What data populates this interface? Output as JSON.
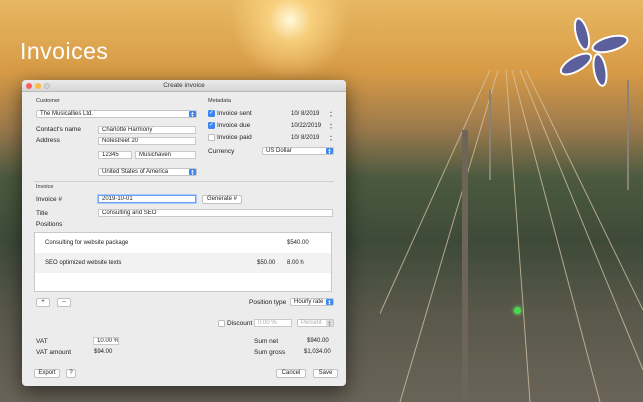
{
  "app": {
    "title": "Invoices"
  },
  "window": {
    "title": "Create invoice"
  },
  "customer": {
    "section_label": "Customer",
    "selected": "The Musicallies Ltd.",
    "contact_label": "Contact's name",
    "contact_value": "Charlotte Harmony",
    "address_label": "Address",
    "street": "Notestreet 20",
    "zip": "12345",
    "city": "Musichaven",
    "country": "United States of America"
  },
  "metadata": {
    "section_label": "Metadata",
    "sent_label": "Invoice sent",
    "sent_date": "10/  8/2019",
    "due_label": "Invoice due",
    "due_date": "10/22/2019",
    "paid_label": "Invoice paid",
    "paid_date": "10/  8/2019",
    "currency_label": "Currency",
    "currency_value": "US Dollar"
  },
  "invoice": {
    "section_label": "Invoice",
    "number_label": "Invoice #",
    "number_value": "2019-10-01",
    "generate_label": "Generate #",
    "title_label": "Title",
    "title_value": "Consulting and SEO",
    "positions_label": "Positions"
  },
  "positions": [
    {
      "description": "Consulting for website package",
      "rate": "",
      "qty": "",
      "amount": "$540.00"
    },
    {
      "description": "SEO optimized website texts",
      "rate": "$50.00",
      "qty": "8.00 h",
      "amount": ""
    }
  ],
  "controls": {
    "add": "+",
    "remove": "–",
    "position_type_label": "Position type",
    "position_type_value": "Hourly rate",
    "discount_label": "Discount",
    "discount_value": "0.00 %",
    "discount_unit": "Percent"
  },
  "totals": {
    "vat_label": "VAT",
    "vat_value": "10.00 %",
    "vat_amount_label": "VAT amount",
    "vat_amount_value": "$94.00",
    "sum_net_label": "Sum net",
    "sum_net_value": "$940.00",
    "sum_gross_label": "Sum gross",
    "sum_gross_value": "$1,034.00"
  },
  "footer": {
    "export": "Export",
    "help": "?",
    "cancel": "Cancel",
    "save": "Save"
  },
  "colors": {
    "accent": "#3c86f3",
    "logo": "#5b5f9c"
  }
}
